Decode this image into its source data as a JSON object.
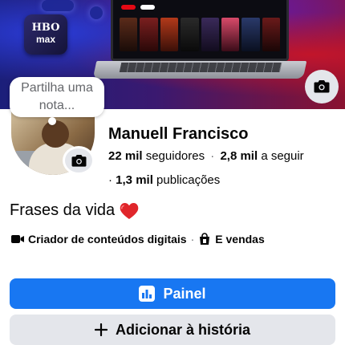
{
  "cover": {
    "brand_tile": {
      "line1": "HBO",
      "line2": "max"
    }
  },
  "note": {
    "text": "Partilha uma nota..."
  },
  "profile": {
    "name": "Manuell Francisco",
    "followers": {
      "count": "22 mil",
      "label": "seguidores"
    },
    "following": {
      "count": "2,8 mil",
      "label": "a seguir"
    },
    "posts": {
      "count": "1,3 mil",
      "label": "publicações"
    },
    "separator": "·"
  },
  "bio": {
    "text": "Frases da vida",
    "emoji": "❤️"
  },
  "details": [
    {
      "icon": "video-icon",
      "text": "Criador de conteúdos digitais"
    },
    {
      "icon": "shop-icon",
      "text": "E vendas"
    }
  ],
  "buttons": {
    "dashboard": {
      "label": "Painel",
      "icon": "chart-icon",
      "color": "#1877f2"
    },
    "add_story": {
      "label": "Adicionar à história",
      "icon": "plus-icon"
    }
  },
  "colors": {
    "accent": "#1877f2",
    "secondary_button": "#e4e6eb",
    "muted_text": "#65676b"
  }
}
